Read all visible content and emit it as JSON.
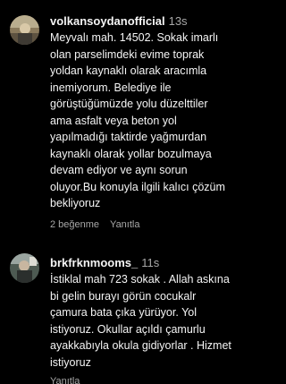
{
  "comments": [
    {
      "username": "volkansoydanofficial",
      "time": "13s",
      "text": "Meyvalı mah. 14502. Sokak imarlı\nolan parselimdeki evime toprak\nyoldan kaynaklı olarak aracımla\ninemiyorum. Belediye ile\ngörüştüğümüzde yolu düzelttiler\nama asfalt veya beton yol\nyapılmadığı taktirde yağmurdan\nkaynaklı olarak yollar bozulmaya\ndevam ediyor ve aynı sorun\noluyor.Bu konuyla ilgili kalıcı çözüm\nbekliyoruz",
      "likes_label": "2 beğenme",
      "reply_label": "Yanıtla"
    },
    {
      "username": "brkfrknmooms_",
      "time": "11s",
      "text": "İstiklal mah 723 sokak . Allah askına\nbi gelin burayı görün cocukalr\nçamura bata çıka yürüyor. Yol\nistiyoruz. Okullar açıldı çamurlu\nayakkabıyla okula gidiyorlar . Hizmet\nistiyoruz",
      "reply_label": "Yanıtla"
    }
  ],
  "colors": {
    "background": "#000000",
    "primary_text": "#f5f5f5",
    "secondary_text": "#a8a8a8"
  }
}
